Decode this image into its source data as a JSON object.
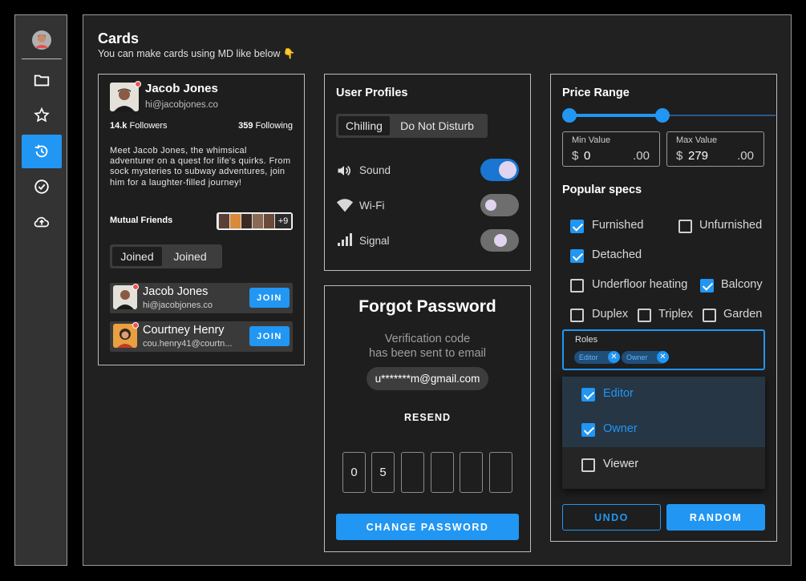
{
  "header": {
    "title": "Cards",
    "subtitle": "You can make cards using MD like below 👇"
  },
  "sidebar": {
    "items": [
      {
        "icon": "avatar"
      },
      {
        "icon": "folder-icon"
      },
      {
        "icon": "star-icon"
      },
      {
        "icon": "history-icon",
        "active": true
      },
      {
        "icon": "check-circle-icon"
      },
      {
        "icon": "cloud-upload-icon"
      }
    ]
  },
  "profile": {
    "name": "Jacob Jones",
    "email": "hi@jacobjones.co",
    "followers_count": "14.k",
    "followers_label": "Followers",
    "following_count": "359",
    "following_label": "Following",
    "bio": "Meet Jacob Jones, the whimsical adventurer on a quest for life's quirks. From sock mysteries to subway adventures, join him for a laughter-filled journey!",
    "mutual_label": "Mutual Friends",
    "mutual_more": "+9",
    "tabs": [
      "Joined",
      "Joined"
    ],
    "friends": [
      {
        "name": "Jacob Jones",
        "email": "hi@jacobjones.co",
        "action": "JOIN"
      },
      {
        "name": "Courtney Henry",
        "email": "cou.henry41@courtn...",
        "action": "JOIN"
      }
    ]
  },
  "user_profiles": {
    "title": "User Profiles",
    "tabs": [
      "Chilling",
      "Do Not Disturb"
    ],
    "settings": [
      {
        "label": "Sound",
        "on": true
      },
      {
        "label": "Wi-Fi",
        "on": false
      },
      {
        "label": "Signal",
        "on": false
      }
    ]
  },
  "forgot": {
    "title": "Forgot Password",
    "message_line1": "Verification code",
    "message_line2": "has been sent to email",
    "email": "u*******m@gmail.com",
    "resend": "RESEND",
    "otp": [
      "0",
      "5",
      "",
      "",
      "",
      ""
    ],
    "submit": "CHANGE PASSWORD"
  },
  "price": {
    "title": "Price Range",
    "min_label": "Min Value",
    "min_currency": "$",
    "min_value": "0",
    "min_cents": ".00",
    "max_label": "Max Value",
    "max_currency": "$",
    "max_value": "279",
    "max_cents": ".00",
    "specs_title": "Popular specs",
    "specs": [
      {
        "label": "Furnished",
        "checked": true
      },
      {
        "label": "Unfurnished",
        "checked": false
      },
      {
        "label": "Detached",
        "checked": true
      },
      {
        "label": "Underfloor heating",
        "checked": false
      },
      {
        "label": "Balcony",
        "checked": true
      },
      {
        "label": "Duplex",
        "checked": false
      },
      {
        "label": "Triplex",
        "checked": false
      },
      {
        "label": "Garden",
        "checked": false
      }
    ],
    "roles_label": "Roles",
    "roles_chips": [
      "Editor",
      "Owner"
    ],
    "roles_options": [
      {
        "label": "Editor",
        "checked": true
      },
      {
        "label": "Owner",
        "checked": true
      },
      {
        "label": "Viewer",
        "checked": false
      }
    ],
    "undo": "UNDO",
    "random": "RANDOM"
  },
  "colors": {
    "accent": "#2196f3",
    "bg": "#212121",
    "card": "#1e1e1e"
  }
}
